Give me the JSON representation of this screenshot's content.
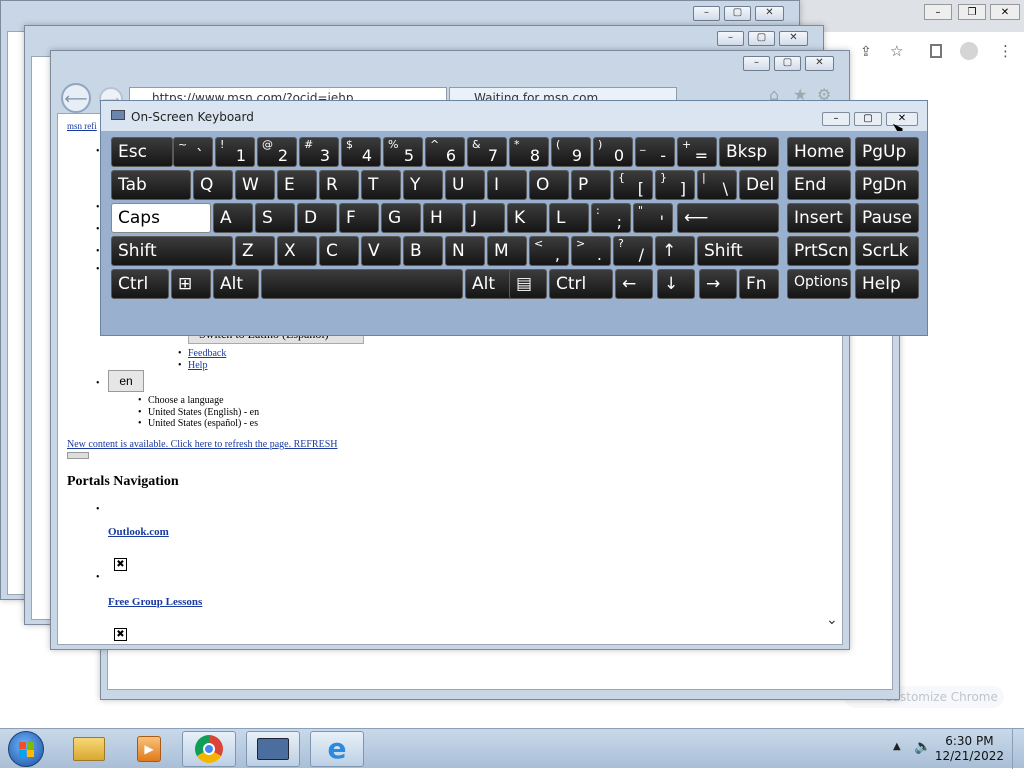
{
  "browser": {
    "url": "https://www.msn.com/?ocid=iehp",
    "tab_title": "Waiting for msn.com...",
    "back_link": "msn refi",
    "header_button_text": "Switch to Latino (Español)",
    "menu_links": [
      "Feedback",
      "Help"
    ],
    "lang_button": "en",
    "lang_items": [
      "Choose a language",
      "United States (English) - en",
      "United States (español) - es"
    ],
    "refresh_text": "New content is available. Click here to refresh the page. REFRESH",
    "portals_heading": "Portals Navigation",
    "portal_links": [
      "Outlook.com",
      "Free Group Lessons"
    ]
  },
  "chrome": {
    "customize_label": "Customize Chrome"
  },
  "osk": {
    "title": "On-Screen Keyboard",
    "rows": [
      [
        {
          "m": "Esc"
        },
        {
          "s": "~",
          "b": "`"
        },
        {
          "s": "!",
          "b": "1"
        },
        {
          "s": "@",
          "b": "2"
        },
        {
          "s": "#",
          "b": "3"
        },
        {
          "s": "$",
          "b": "4"
        },
        {
          "s": "%",
          "b": "5"
        },
        {
          "s": "^",
          "b": "6"
        },
        {
          "s": "&",
          "b": "7"
        },
        {
          "s": "*",
          "b": "8"
        },
        {
          "s": "(",
          "b": "9"
        },
        {
          "s": ")",
          "b": "0"
        },
        {
          "s": "_",
          "b": "-"
        },
        {
          "s": "+",
          "b": "="
        },
        {
          "m": "Bksp"
        },
        {
          "m": "Home"
        },
        {
          "m": "PgUp"
        }
      ],
      [
        {
          "m": "Tab"
        },
        {
          "m": "Q"
        },
        {
          "m": "W"
        },
        {
          "m": "E"
        },
        {
          "m": "R"
        },
        {
          "m": "T"
        },
        {
          "m": "Y"
        },
        {
          "m": "U"
        },
        {
          "m": "I"
        },
        {
          "m": "O"
        },
        {
          "m": "P"
        },
        {
          "s": "{",
          "b": "["
        },
        {
          "s": "}",
          "b": "]"
        },
        {
          "s": "|",
          "b": "\\"
        },
        {
          "m": "Del"
        },
        {
          "m": "End"
        },
        {
          "m": "PgDn"
        }
      ],
      [
        {
          "m": "Caps"
        },
        {
          "m": "A"
        },
        {
          "m": "S"
        },
        {
          "m": "D"
        },
        {
          "m": "F"
        },
        {
          "m": "G"
        },
        {
          "m": "H"
        },
        {
          "m": "J"
        },
        {
          "m": "K"
        },
        {
          "m": "L"
        },
        {
          "s": ":",
          "b": ";"
        },
        {
          "s": "\"",
          "b": "'"
        },
        {
          "m": "⟵"
        },
        {
          "m": "Insert"
        },
        {
          "m": "Pause"
        }
      ],
      [
        {
          "m": "Shift"
        },
        {
          "m": "Z"
        },
        {
          "m": "X"
        },
        {
          "m": "C"
        },
        {
          "m": "V"
        },
        {
          "m": "B"
        },
        {
          "m": "N"
        },
        {
          "m": "M"
        },
        {
          "s": "<",
          "b": ","
        },
        {
          "s": ">",
          "b": "."
        },
        {
          "s": "?",
          "b": "/"
        },
        {
          "m": "↑"
        },
        {
          "m": "Shift"
        },
        {
          "m": "PrtScn"
        },
        {
          "m": "ScrLk"
        }
      ],
      [
        {
          "m": "Ctrl"
        },
        {
          "m": "⊞"
        },
        {
          "m": "Alt"
        },
        {
          "m": ""
        },
        {
          "m": "Alt"
        },
        {
          "m": "▤"
        },
        {
          "m": "Ctrl"
        },
        {
          "m": "←"
        },
        {
          "m": "↓"
        },
        {
          "m": "→"
        },
        {
          "m": "Fn"
        },
        {
          "m": "Options"
        },
        {
          "m": "Help"
        }
      ]
    ]
  },
  "taskbar": {
    "time": "6:30 PM",
    "date": "12/21/2022"
  },
  "colors": {
    "osk_body": "#99b1cf",
    "key_dark": "#1e1e1e",
    "taskbar": "#b9cde2"
  }
}
